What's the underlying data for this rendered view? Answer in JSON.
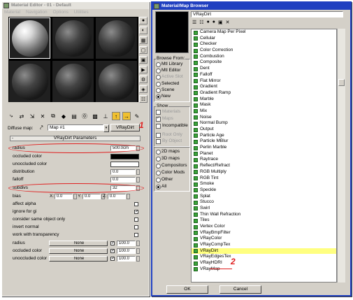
{
  "material_editor": {
    "title": "Material Editor - 01 - Default",
    "menu": [
      "Material",
      "Navigation",
      "Options",
      "Utilities"
    ],
    "diffuse_label": "Diffuse map:",
    "map_name": "Map #1",
    "map_type": "VRayDirt",
    "rollout_title": "VRayDirt Parameters",
    "params": [
      {
        "label": "radius",
        "value": "500.0cm",
        "kind": "num",
        "circled": true
      },
      {
        "label": "occluded color",
        "kind": "color",
        "color": "#000000"
      },
      {
        "label": "unoccluded color",
        "kind": "color",
        "color": "#ffffff"
      },
      {
        "label": "distribution",
        "value": "0.0",
        "kind": "num"
      },
      {
        "label": "falloff",
        "value": "0.0",
        "kind": "num"
      },
      {
        "label": "subdivs",
        "value": "32",
        "kind": "num",
        "circled": true
      },
      {
        "label": "bias",
        "kind": "xyz",
        "x": "0.0",
        "y": "0.0",
        "z": "0.0"
      },
      {
        "label": "affect alpha",
        "kind": "check",
        "checked": false
      },
      {
        "label": "ignore for gi",
        "kind": "check",
        "checked": true
      },
      {
        "label": "consider same object only",
        "kind": "check",
        "checked": false
      },
      {
        "label": "invert normal",
        "kind": "check",
        "checked": false
      },
      {
        "label": "work with transparency",
        "kind": "check",
        "checked": false
      },
      {
        "label": "radius",
        "kind": "map",
        "map": "None",
        "checked": true,
        "amount": "100.0"
      },
      {
        "label": "occluded color",
        "kind": "map",
        "map": "None",
        "checked": true,
        "amount": "100.0"
      },
      {
        "label": "unoccluded color",
        "kind": "map",
        "map": "None",
        "checked": true,
        "amount": "100.0"
      }
    ],
    "annotation": "1",
    "xyz_labels": [
      "X:",
      "Y:",
      "Z:"
    ]
  },
  "browser": {
    "title": "Material/Map Browser",
    "search_value": "VRayDirt",
    "browse_from_label": "Browse From:",
    "browse_from": [
      {
        "label": "Mtl Library",
        "selected": false,
        "disabled": false
      },
      {
        "label": "Mtl Editor",
        "selected": false,
        "disabled": false
      },
      {
        "label": "Active Slot",
        "selected": false,
        "disabled": true
      },
      {
        "label": "Selected",
        "selected": false,
        "disabled": false
      },
      {
        "label": "Scene",
        "selected": false,
        "disabled": false
      },
      {
        "label": "New",
        "selected": true,
        "disabled": false
      }
    ],
    "show_label": "Show",
    "show_options": [
      {
        "label": "Materials",
        "checked": false,
        "disabled": true
      },
      {
        "label": "Maps",
        "checked": true,
        "disabled": true
      },
      {
        "label": "Incompatible",
        "checked": false,
        "disabled": false
      }
    ],
    "root_options": [
      {
        "label": "Root Only",
        "checked": false
      },
      {
        "label": "By Object",
        "checked": false
      }
    ],
    "categories": [
      {
        "label": "2D maps",
        "selected": false
      },
      {
        "label": "3D maps",
        "selected": false
      },
      {
        "label": "Compositors",
        "selected": false
      },
      {
        "label": "Color Mods",
        "selected": false
      },
      {
        "label": "Other",
        "selected": false
      },
      {
        "label": "All",
        "selected": true
      }
    ],
    "items": [
      "Camera Map Per Pixel",
      "Cellular",
      "Checker",
      "Color Correction",
      "Combustion",
      "Composite",
      "Dent",
      "Falloff",
      "Flat Mirror",
      "Gradient",
      "Gradient Ramp",
      "Marble",
      "Mask",
      "Mix",
      "Noise",
      "Normal Bump",
      "Output",
      "Particle Age",
      "Particle MBlur",
      "Perlin Marble",
      "Planet",
      "Raytrace",
      "Reflect/Refract",
      "RGB Multiply",
      "RGB Tint",
      "Smoke",
      "Speckle",
      "Splat",
      "Stucco",
      "Swirl",
      "Thin Wall Refraction",
      "Tiles",
      "Vertex Color",
      "VRayBmpFilter",
      "VRayColor",
      "VRayCompTex",
      "VRayDirt",
      "VRayEdgesTex",
      "VRayHDRI",
      "VRayMap"
    ],
    "selected_item": "VRayDirt",
    "annotation": "2",
    "ok_label": "OK",
    "cancel_label": "Cancel"
  }
}
